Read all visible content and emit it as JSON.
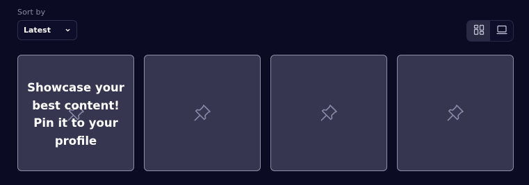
{
  "sort": {
    "label": "Sort by",
    "selected": "Latest"
  },
  "view_toggle": {
    "options": [
      {
        "icon": "grid-layout-icon",
        "active": true
      },
      {
        "icon": "monitor-icon",
        "active": false
      }
    ]
  },
  "pins": {
    "prompt_line1": "Showcase your",
    "prompt_line2": "best content!",
    "prompt_line3": "Pin it to your",
    "prompt_line4": "profile",
    "tiles": [
      {
        "icon": "pin-icon"
      },
      {
        "icon": "pin-icon"
      },
      {
        "icon": "pin-icon"
      },
      {
        "icon": "pin-icon"
      }
    ]
  },
  "colors": {
    "background": "#0b0b24",
    "tile": "#363650",
    "tile_border": "#8d8da8",
    "pin_icon": "#8a8aa6"
  }
}
